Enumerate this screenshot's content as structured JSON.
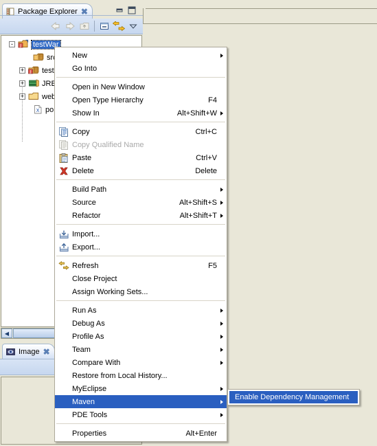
{
  "window": {
    "background_color": "#e9e7d8",
    "selection_color": "#2a5fc0",
    "tree_selection_color": "#316ac5"
  },
  "package_explorer": {
    "tab_label": "Package Explorer",
    "tab_icon": "package-explorer-icon",
    "close_icon": "close-icon",
    "minimize_icon": "minimize-icon",
    "maximize_icon": "maximize-icon",
    "toolbar": [
      {
        "name": "back-button",
        "icon": "arrow-left-icon",
        "enabled": false
      },
      {
        "name": "forward-button",
        "icon": "arrow-right-icon",
        "enabled": false
      },
      {
        "name": "up-button",
        "icon": "go-up-icon",
        "enabled": false
      },
      {
        "name": "collapse-all-button",
        "icon": "collapse-all-icon",
        "enabled": true
      },
      {
        "name": "link-with-editor-button",
        "icon": "link-with-editor-icon",
        "enabled": true
      },
      {
        "name": "view-menu-button",
        "icon": "chevron-down-icon",
        "enabled": true
      }
    ],
    "tree": [
      {
        "label": "testWar",
        "icon": "web-project-icon",
        "expander": "-",
        "indent": 0,
        "selected": true
      },
      {
        "label": "src",
        "icon": "source-folder-icon",
        "expander": "",
        "indent": 1,
        "selected": false
      },
      {
        "label": "test",
        "icon": "source-folder-icon",
        "expander": "+",
        "indent": 1,
        "selected": false
      },
      {
        "label": "JRE",
        "icon": "jre-library-icon",
        "expander": "+",
        "indent": 1,
        "selected": false
      },
      {
        "label": "web",
        "icon": "folder-icon",
        "expander": "+",
        "indent": 1,
        "selected": false
      },
      {
        "label": "pom",
        "icon": "xml-file-icon",
        "expander": "",
        "indent": 1,
        "selected": false
      }
    ],
    "hscroll": {
      "left_arrow": "◀",
      "right_arrow": "▶"
    }
  },
  "image_view": {
    "tab_label": "Image",
    "tab_icon": "image-view-icon",
    "close_icon": "close-icon",
    "toolbar": [
      {
        "name": "link-with-editor-button",
        "icon": "link-with-editor-icon",
        "enabled": true
      },
      {
        "name": "image-tool-button",
        "icon": "picture-icon",
        "enabled": true
      }
    ]
  },
  "context_menu": {
    "items": [
      {
        "label": "New",
        "accel": "",
        "icon": "",
        "submenu": true,
        "separator_after": false,
        "disabled": false,
        "selected": false
      },
      {
        "label": "Go Into",
        "accel": "",
        "icon": "",
        "submenu": false,
        "separator_after": true,
        "disabled": false,
        "selected": false
      },
      {
        "label": "Open in New Window",
        "accel": "",
        "icon": "",
        "submenu": false,
        "separator_after": false,
        "disabled": false,
        "selected": false
      },
      {
        "label": "Open Type Hierarchy",
        "accel": "F4",
        "icon": "",
        "submenu": false,
        "separator_after": false,
        "disabled": false,
        "selected": false
      },
      {
        "label": "Show In",
        "accel": "Alt+Shift+W",
        "icon": "",
        "submenu": true,
        "separator_after": true,
        "disabled": false,
        "selected": false
      },
      {
        "label": "Copy",
        "accel": "Ctrl+C",
        "icon": "copy-icon",
        "submenu": false,
        "separator_after": false,
        "disabled": false,
        "selected": false
      },
      {
        "label": "Copy Qualified Name",
        "accel": "",
        "icon": "copy-qualified-name-icon",
        "submenu": false,
        "separator_after": false,
        "disabled": true,
        "selected": false
      },
      {
        "label": "Paste",
        "accel": "Ctrl+V",
        "icon": "paste-icon",
        "submenu": false,
        "separator_after": false,
        "disabled": false,
        "selected": false
      },
      {
        "label": "Delete",
        "accel": "Delete",
        "icon": "delete-icon",
        "submenu": false,
        "separator_after": true,
        "disabled": false,
        "selected": false
      },
      {
        "label": "Build Path",
        "accel": "",
        "icon": "",
        "submenu": true,
        "separator_after": false,
        "disabled": false,
        "selected": false
      },
      {
        "label": "Source",
        "accel": "Alt+Shift+S",
        "icon": "",
        "submenu": true,
        "separator_after": false,
        "disabled": false,
        "selected": false
      },
      {
        "label": "Refactor",
        "accel": "Alt+Shift+T",
        "icon": "",
        "submenu": true,
        "separator_after": true,
        "disabled": false,
        "selected": false
      },
      {
        "label": "Import...",
        "accel": "",
        "icon": "import-icon",
        "submenu": false,
        "separator_after": false,
        "disabled": false,
        "selected": false
      },
      {
        "label": "Export...",
        "accel": "",
        "icon": "export-icon",
        "submenu": false,
        "separator_after": true,
        "disabled": false,
        "selected": false
      },
      {
        "label": "Refresh",
        "accel": "F5",
        "icon": "refresh-icon",
        "submenu": false,
        "separator_after": false,
        "disabled": false,
        "selected": false
      },
      {
        "label": "Close Project",
        "accel": "",
        "icon": "",
        "submenu": false,
        "separator_after": false,
        "disabled": false,
        "selected": false
      },
      {
        "label": "Assign Working Sets...",
        "accel": "",
        "icon": "",
        "submenu": false,
        "separator_after": true,
        "disabled": false,
        "selected": false
      },
      {
        "label": "Run As",
        "accel": "",
        "icon": "",
        "submenu": true,
        "separator_after": false,
        "disabled": false,
        "selected": false
      },
      {
        "label": "Debug As",
        "accel": "",
        "icon": "",
        "submenu": true,
        "separator_after": false,
        "disabled": false,
        "selected": false
      },
      {
        "label": "Profile As",
        "accel": "",
        "icon": "",
        "submenu": true,
        "separator_after": false,
        "disabled": false,
        "selected": false
      },
      {
        "label": "Team",
        "accel": "",
        "icon": "",
        "submenu": true,
        "separator_after": false,
        "disabled": false,
        "selected": false
      },
      {
        "label": "Compare With",
        "accel": "",
        "icon": "",
        "submenu": true,
        "separator_after": false,
        "disabled": false,
        "selected": false
      },
      {
        "label": "Restore from Local History...",
        "accel": "",
        "icon": "",
        "submenu": false,
        "separator_after": false,
        "disabled": false,
        "selected": false
      },
      {
        "label": "MyEclipse",
        "accel": "",
        "icon": "",
        "submenu": true,
        "separator_after": false,
        "disabled": false,
        "selected": false
      },
      {
        "label": "Maven",
        "accel": "",
        "icon": "",
        "submenu": true,
        "separator_after": false,
        "disabled": false,
        "selected": true
      },
      {
        "label": "PDE Tools",
        "accel": "",
        "icon": "",
        "submenu": true,
        "separator_after": true,
        "disabled": false,
        "selected": false
      },
      {
        "label": "Properties",
        "accel": "Alt+Enter",
        "icon": "",
        "submenu": false,
        "separator_after": false,
        "disabled": false,
        "selected": false
      }
    ]
  },
  "submenu": {
    "items": [
      {
        "label": "Enable Dependency Management",
        "selected": true
      }
    ]
  }
}
